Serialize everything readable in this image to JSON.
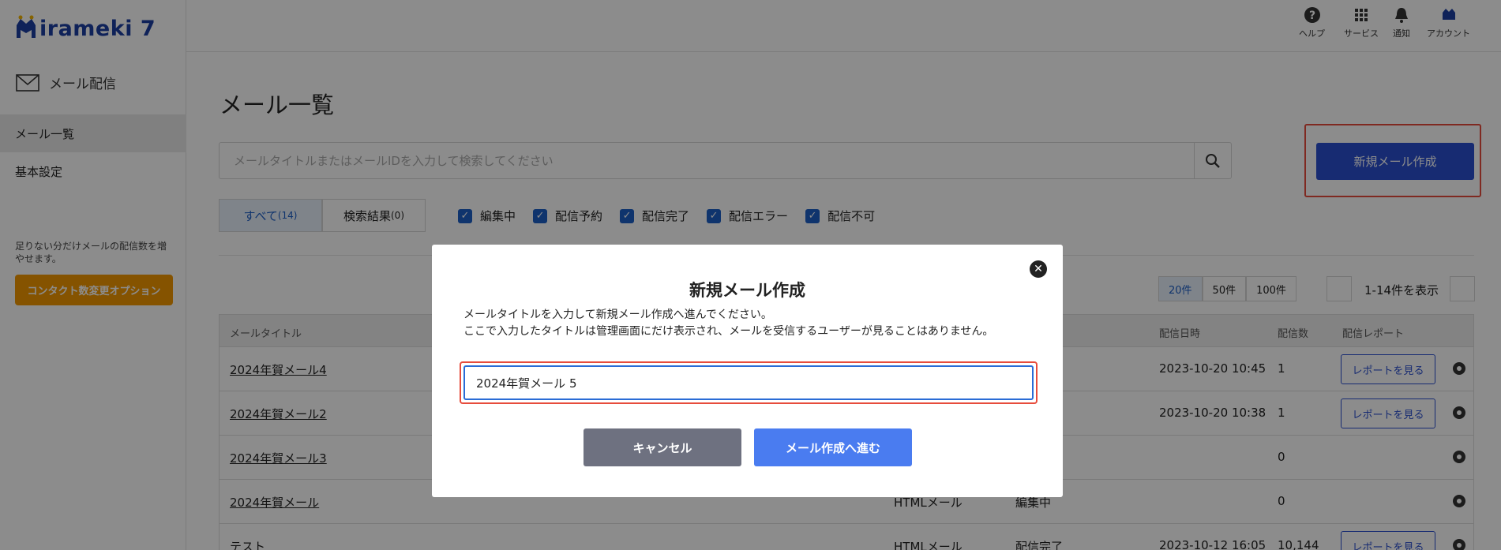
{
  "app": {
    "logo_text": "irameki 7"
  },
  "header": {
    "actions": [
      {
        "label": "ヘルプ",
        "icon": "help-icon"
      },
      {
        "label": "サービス",
        "icon": "grid-icon"
      },
      {
        "label": "通知",
        "icon": "bell-icon"
      },
      {
        "label": "アカウント",
        "icon": "account-icon"
      }
    ]
  },
  "sidebar": {
    "section_title": "メール配信",
    "items": [
      {
        "label": "メール一覧",
        "active": true
      },
      {
        "label": "基本設定",
        "active": false
      }
    ],
    "note": "足りない分だけメールの配信数を増やせます。",
    "option_button": "コンタクト数変更オプション"
  },
  "main": {
    "title": "メール一覧",
    "search_placeholder": "メールタイトルまたはメールIDを入力して検索してください",
    "new_mail_button": "新規メール作成",
    "tabs": [
      {
        "label": "すべて",
        "count": "(14)",
        "active": true
      },
      {
        "label": "検索結果",
        "count": "(0)",
        "active": false
      }
    ],
    "filters": [
      "編集中",
      "配信予約",
      "配信完了",
      "配信エラー",
      "配信不可"
    ],
    "page_sizes": [
      {
        "label": "20件",
        "active": true
      },
      {
        "label": "50件",
        "active": false
      },
      {
        "label": "100件",
        "active": false
      }
    ],
    "range_text": "1-14件を表示",
    "table": {
      "headers": {
        "title": "メールタイトル",
        "date": "配信日時",
        "count": "配信数",
        "report": "配信レポート"
      },
      "report_button": "レポートを見る",
      "rows": [
        {
          "title": "2024年賀メール4",
          "type": "",
          "status": "",
          "date": "2023-10-20 10:45",
          "count": "1",
          "has_report": true
        },
        {
          "title": "2024年賀メール2",
          "type": "",
          "status": "",
          "date": "2023-10-20 10:38",
          "count": "1",
          "has_report": true
        },
        {
          "title": "2024年賀メール3",
          "type": "",
          "status": "",
          "date": "",
          "count": "0",
          "has_report": false
        },
        {
          "title": "2024年賀メール",
          "type": "HTMLメール",
          "status": "編集中",
          "date": "",
          "count": "0",
          "has_report": false
        },
        {
          "title": "テスト",
          "type": "HTMLメール",
          "status": "配信完了",
          "date": "2023-10-12 16:05",
          "count": "10,144",
          "has_report": true
        }
      ]
    }
  },
  "modal": {
    "title": "新規メール作成",
    "desc_line1": "メールタイトルを入力して新規メール作成へ進んでください。",
    "desc_line2": "ここで入力したタイトルは管理画面にだけ表示され、メールを受信するユーザーが見ることはありません。",
    "input_value": "2024年賀メール 5",
    "cancel_button": "キャンセル",
    "proceed_button": "メール作成へ進む"
  },
  "colors": {
    "brand": "#1d3fa3",
    "primary": "#2a4fcf",
    "highlight": "#e74c3c",
    "option": "#f39800"
  }
}
